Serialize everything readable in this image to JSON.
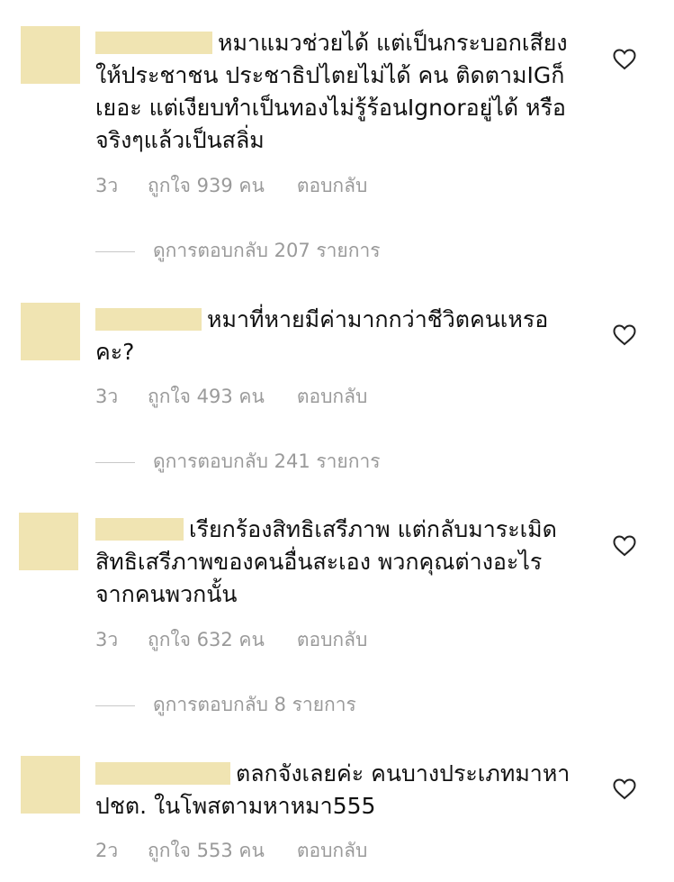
{
  "colors": {
    "redaction": "#f0e4b2",
    "meta_text": "#9a9a9a",
    "body_text": "#111111",
    "heart_stroke": "#222222"
  },
  "comments": [
    {
      "text": "หมาแมวช่วยได้ แต่เป็นกระบอกเสียงให้ประชาชน ประชาธิปไตยไม่ได้ คน ติดตามIGก็เยอะ แต่เงียบทำเป็นทองไม่รู้ร้อนIgnorอยู่ได้ หรือจริงๆแล้วเป็นสลิ่ม",
      "time": "3ว",
      "likes": "ถูกใจ 939 คน",
      "reply": "ตอบกลับ",
      "view_replies": "ดูการตอบกลับ 207 รายการ",
      "heart_icon": "heart-outline-icon"
    },
    {
      "text": "หมาที่หายมีค่ามากกว่าชีวิตคนเหรอคะ?",
      "time": "3ว",
      "likes": "ถูกใจ 493 คน",
      "reply": "ตอบกลับ",
      "view_replies": "ดูการตอบกลับ 241 รายการ",
      "heart_icon": "heart-outline-icon"
    },
    {
      "text": "เรียกร้องสิทธิเสรีภาพ แต่กลับมาระเมิดสิทธิเสรีภาพของคนอื่นสะเอง พวกคุณต่างอะไรจากคนพวกนั้น",
      "time": "3ว",
      "likes": "ถูกใจ 632 คน",
      "reply": "ตอบกลับ",
      "view_replies": "ดูการตอบกลับ 8 รายการ",
      "heart_icon": "heart-outline-icon"
    },
    {
      "text": "ตลกจังเลยค่ะ คนบางประเภทมาหา ปชต. ในโพสตามหาหมา555",
      "time": "2ว",
      "likes": "ถูกใจ 553 คน",
      "reply": "ตอบกลับ",
      "heart_icon": "heart-outline-icon"
    }
  ]
}
